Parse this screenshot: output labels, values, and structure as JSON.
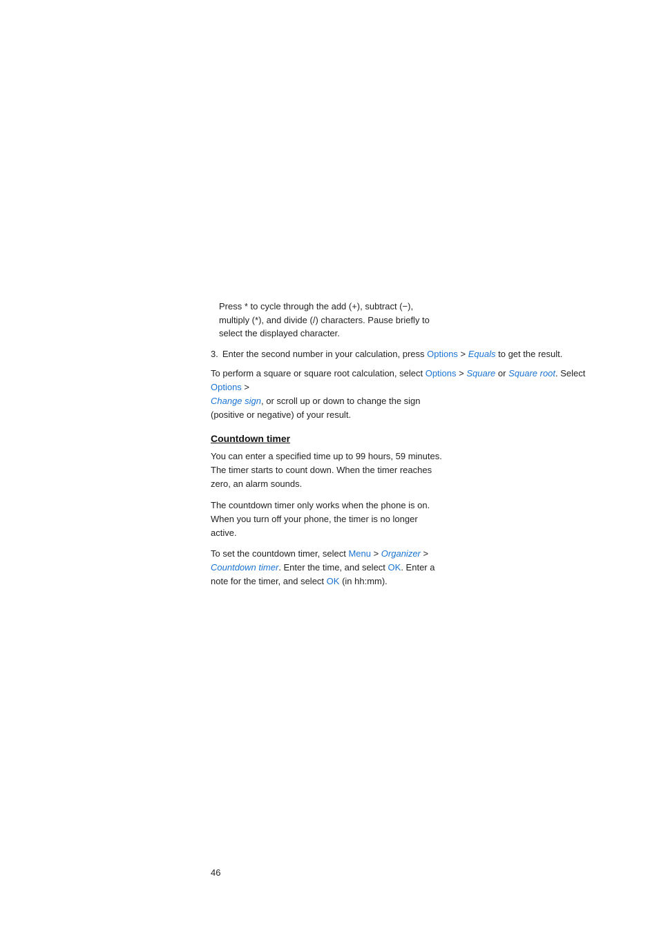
{
  "page": {
    "background": "#ffffff",
    "page_number": "46"
  },
  "content": {
    "step3_label": "3.",
    "step3_text": "Enter the second number in your calculation, press",
    "step3_link1": "Options",
    "step3_separator": " > ",
    "step3_link2": "Equals",
    "step3_suffix": " to get the result.",
    "para_square_prefix": "To perform a square or square root calculation, select",
    "para_square_link1": "Options",
    "para_square_sep1": " > ",
    "para_square_link2": "Square",
    "para_square_mid": " or ",
    "para_square_link3": "Square root",
    "para_square_period": ". Select ",
    "para_square_link4": "Options",
    "para_square_sep2": " >",
    "para_square_link5": "Change sign",
    "para_square_end": ", or scroll up or down to change the sign (positive or negative) of your result.",
    "indent_text1": "Press * to cycle through the add (+), subtract (−),",
    "indent_text2": "multiply (*), and divide (/) characters. Pause briefly to",
    "indent_text3": "select the displayed character.",
    "section_heading": "Countdown timer",
    "countdown_para1_line1": "You can enter a specified time up to 99 hours, 59 minutes.",
    "countdown_para1_line2": "The timer starts to count down. When the timer reaches",
    "countdown_para1_line3": "zero, an alarm sounds.",
    "countdown_para2_line1": "The countdown timer only works when the phone is on.",
    "countdown_para2_line2": "When you turn off your phone, the timer is no longer",
    "countdown_para2_line3": "active.",
    "countdown_para3_prefix": "To set the countdown timer, select ",
    "countdown_para3_link1": "Menu",
    "countdown_para3_sep1": " > ",
    "countdown_para3_link2": "Organizer",
    "countdown_para3_sep2": " >",
    "countdown_para3_newline": "",
    "countdown_para3_link3": "Countdown timer",
    "countdown_para3_mid": ". Enter the time, and select ",
    "countdown_para3_link4": "OK",
    "countdown_para3_mid2": ". Enter a",
    "countdown_para3_end_prefix": "note for the timer, and select ",
    "countdown_para3_link5": "OK",
    "countdown_para3_end": " (in hh:mm).",
    "colors": {
      "link": "#1a73d4",
      "text": "#222222",
      "heading": "#111111"
    }
  }
}
